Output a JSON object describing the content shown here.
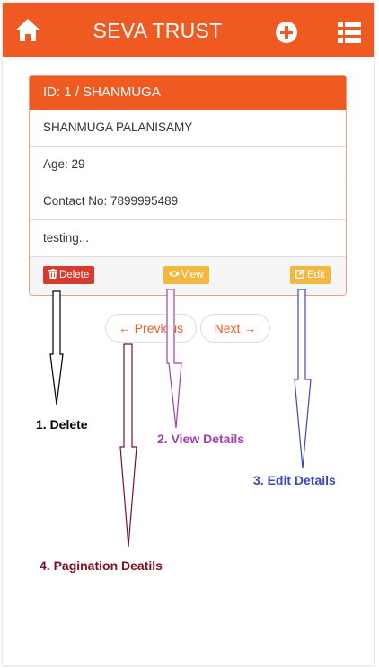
{
  "header": {
    "title": "SEVA TRUST",
    "home_icon": "home-icon",
    "add_icon": "plus-circle-icon",
    "menu_icon": "list-icon",
    "color": "#ef5a23"
  },
  "card": {
    "title": "ID: 1 / SHANMUGA",
    "name": "SHANMUGA PALANISAMY",
    "age": "Age: 29",
    "contact": "Contact No: 7899995489",
    "note": "testing..."
  },
  "actions": {
    "delete_label": "Delete",
    "view_label": "View",
    "edit_label": "Edit"
  },
  "pagination": {
    "previous_label": "← Previous",
    "next_label": "Next →"
  },
  "annotations": [
    {
      "label": "1. Delete",
      "color": "#000000"
    },
    {
      "label": "2. View Details",
      "color": "#a040b0"
    },
    {
      "label": "3. Edit Details",
      "color": "#3b45c4"
    },
    {
      "label": "4. Pagination Deatils",
      "color": "#7a1020"
    }
  ]
}
